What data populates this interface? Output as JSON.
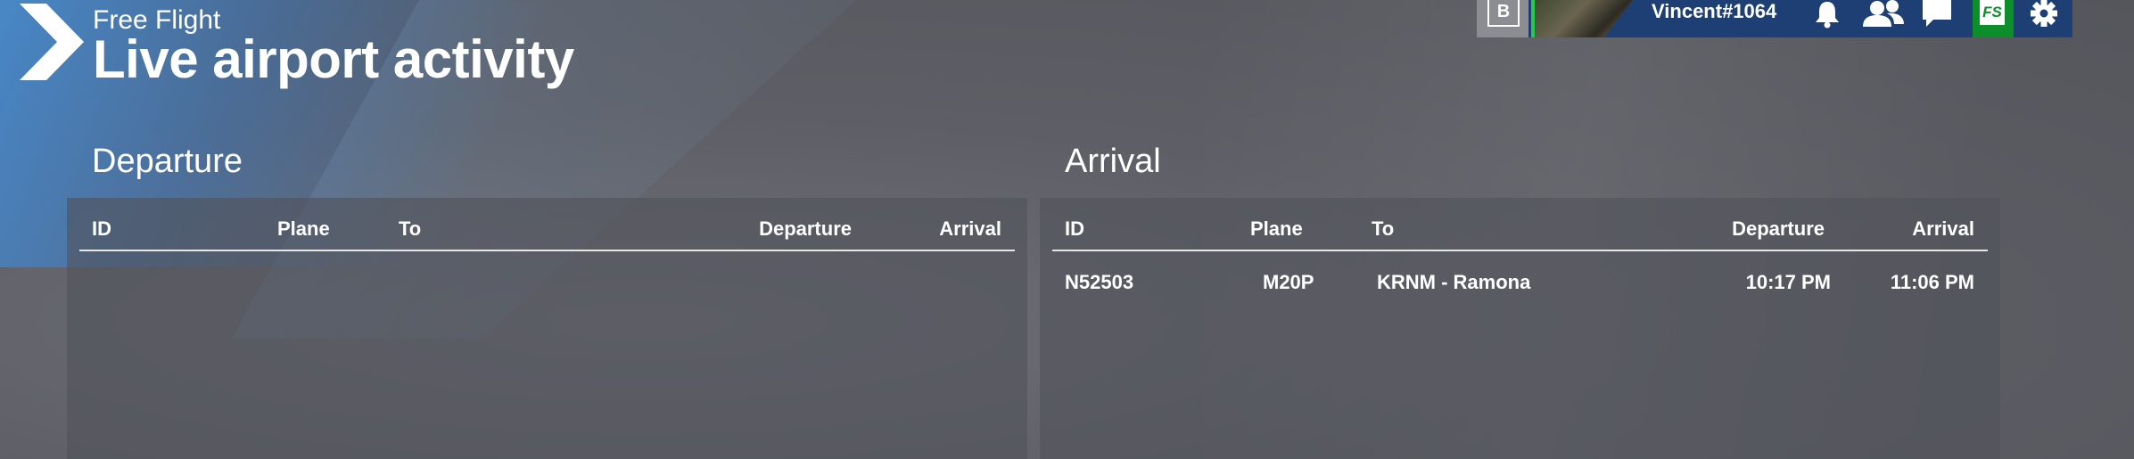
{
  "header": {
    "subtitle": "Free Flight",
    "title": "Live airport activity"
  },
  "topbar": {
    "b_label": "B",
    "username": "Vincent#1064",
    "fs_label": "FS",
    "icons": [
      "bell-icon",
      "friends-icon",
      "chat-icon",
      "fs-logo",
      "gear-icon"
    ],
    "colors": {
      "bar": "#1e3f74",
      "online": "#28c84a",
      "fs_green": "#0c8e2b"
    }
  },
  "departure": {
    "label": "Departure",
    "columns": [
      "ID",
      "Plane",
      "To",
      "Departure",
      "Arrival"
    ],
    "rows": []
  },
  "arrival": {
    "label": "Arrival",
    "columns": [
      "ID",
      "Plane",
      "To",
      "Departure",
      "Arrival"
    ],
    "rows": [
      {
        "id": "N52503",
        "plane": "M20P",
        "to": "KRNM - Ramona",
        "departure": "10:17 PM",
        "arrival": "11:06 PM"
      }
    ]
  }
}
